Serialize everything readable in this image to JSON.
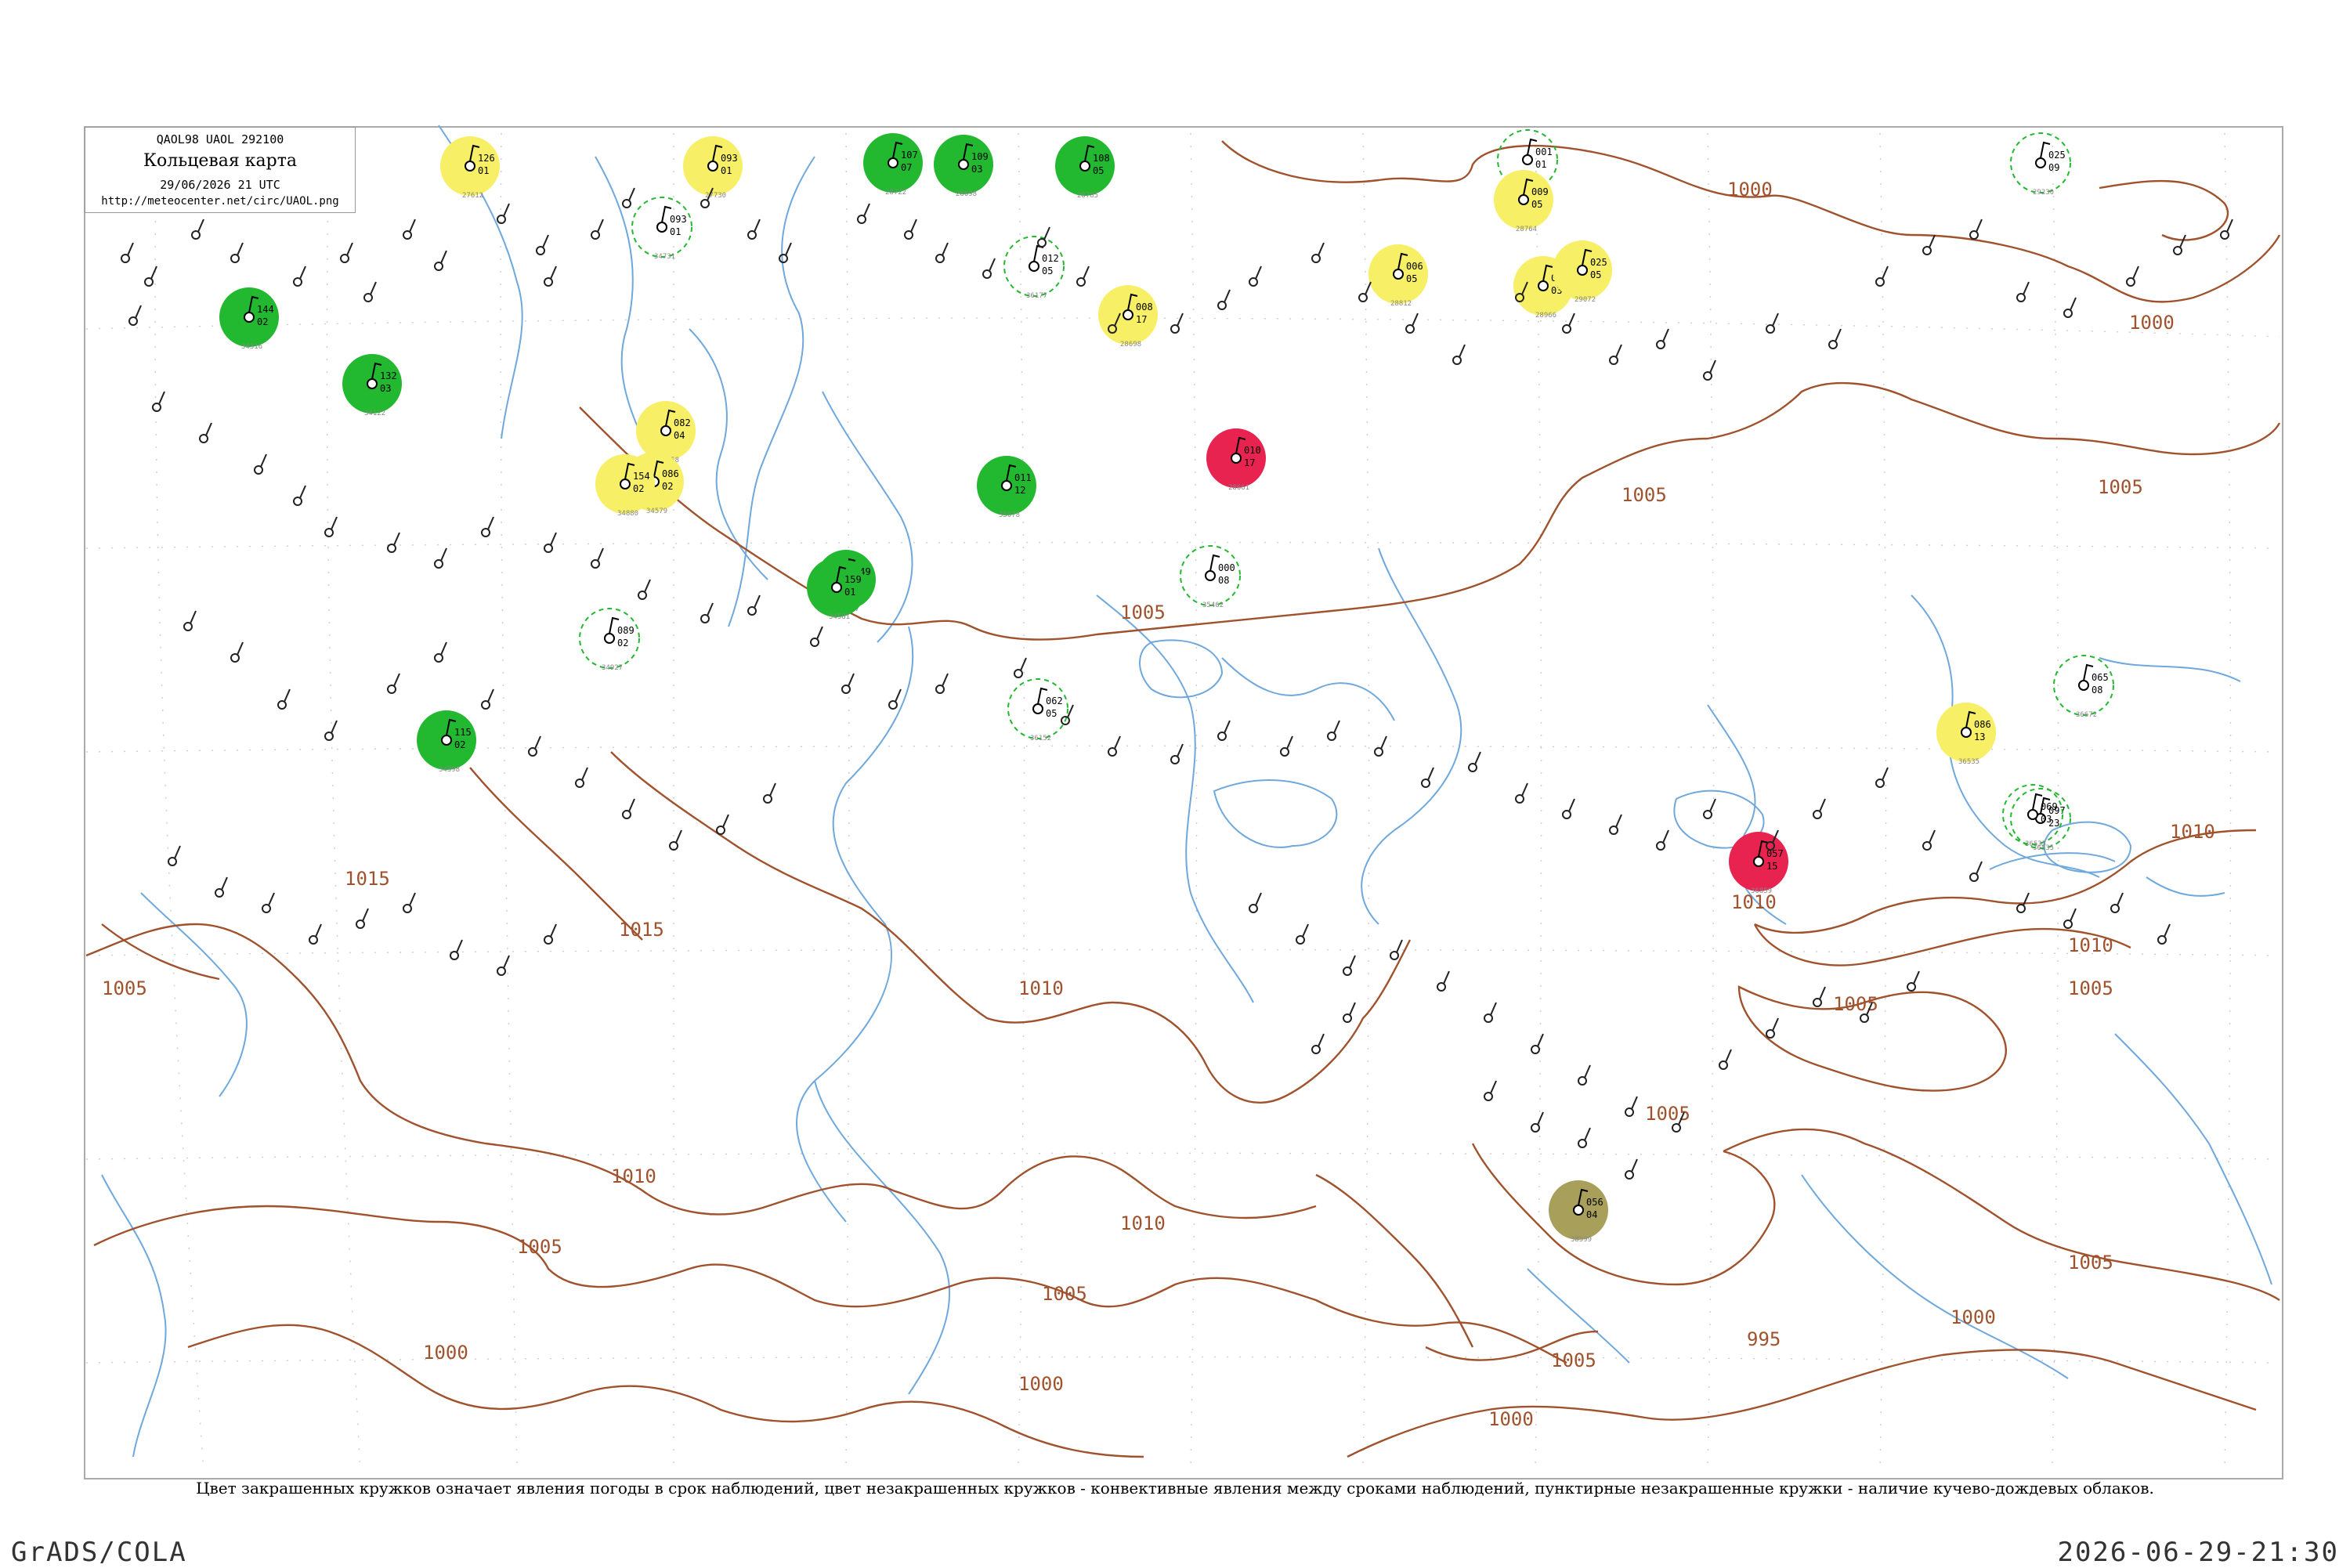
{
  "legend": {
    "header": "QAOL98  UAOL  292100",
    "title": "Кольцевая карта",
    "datetime": "29/06/2026 21 UTC",
    "url": "http://meteocenter.net/circ/UAOL.png"
  },
  "footnote": "Цвет закрашенных кружков означает явления погоды в срок наблюдений, цвет незакрашенных кружков - конвективные явления между сроками наблюдений, пунктирные незакрашенные кружки - наличие кучево-дождевых облаков.",
  "footer": {
    "software": "GrADS/COLA",
    "timestamp": "2026-06-29-21:30"
  },
  "colors": {
    "isobar": "#a0522d",
    "water": "#6fa8dc",
    "thunder": "#22b830",
    "shower": "#f7ef66",
    "fog": "#e8234f",
    "dust": "#a89f5a",
    "station": "#000000",
    "label": "#888888"
  },
  "isobar_labels": [
    "1000",
    "1005",
    "1010",
    "1015",
    "995"
  ],
  "stations": [
    {
      "p": "126",
      "t": "01",
      "id": "27612",
      "fill": "shower"
    },
    {
      "p": "093",
      "t": "01",
      "id": "27730",
      "fill": "shower"
    },
    {
      "p": "107",
      "t": "07",
      "id": "28722",
      "fill": "thunder"
    },
    {
      "p": "109",
      "t": "03",
      "id": "28698",
      "fill": "thunder"
    },
    {
      "p": "108",
      "t": "05",
      "id": "28785",
      "fill": "thunder"
    },
    {
      "p": "008",
      "t": "17",
      "id": "28698",
      "fill": "shower"
    },
    {
      "p": "001",
      "t": "01",
      "id": "28573",
      "fill": "none"
    },
    {
      "p": "009",
      "t": "05",
      "id": "28764",
      "fill": "shower"
    },
    {
      "p": "025",
      "t": "09",
      "id": "29230",
      "fill": "none"
    },
    {
      "p": "006",
      "t": "05",
      "id": "28812",
      "fill": "shower"
    },
    {
      "p": "020",
      "t": "03",
      "id": "28966",
      "fill": "shower"
    },
    {
      "p": "025",
      "t": "05",
      "id": "29072",
      "fill": "shower"
    },
    {
      "p": "144",
      "t": "02",
      "id": "34316",
      "fill": "thunder"
    },
    {
      "p": "132",
      "t": "03",
      "id": "34122",
      "fill": "thunder"
    },
    {
      "p": "082",
      "t": "04",
      "id": "34858",
      "fill": "shower"
    },
    {
      "p": "086",
      "t": "02",
      "id": "34579",
      "fill": "shower"
    },
    {
      "p": "154",
      "t": "02",
      "id": "34880",
      "fill": "shower"
    },
    {
      "p": "010",
      "t": "17",
      "id": "28661",
      "fill": "fog"
    },
    {
      "p": "011",
      "t": "12",
      "id": "35078",
      "fill": "thunder"
    },
    {
      "p": "012",
      "t": "05",
      "id": "36177",
      "fill": "none"
    },
    {
      "p": "093",
      "t": "01",
      "id": "34731",
      "fill": "none"
    },
    {
      "p": "149",
      "t": "01",
      "id": "34337",
      "fill": "thunder"
    },
    {
      "p": "115",
      "t": "02",
      "id": "34398",
      "fill": "thunder"
    },
    {
      "p": "159",
      "t": "01",
      "id": "34581",
      "fill": "thunder"
    },
    {
      "p": "086",
      "t": "13",
      "id": "36535",
      "fill": "shower"
    },
    {
      "p": "065",
      "t": "08",
      "id": "36672",
      "fill": "none"
    },
    {
      "p": "097",
      "t": "23",
      "id": "36535",
      "fill": "none"
    },
    {
      "p": "069",
      "t": "03",
      "id": "36535",
      "fill": "none"
    },
    {
      "p": "057",
      "t": "15",
      "id": "36859",
      "fill": "fog"
    },
    {
      "p": "056",
      "t": "04",
      "id": "38599",
      "fill": "dust"
    },
    {
      "p": "000",
      "t": "08",
      "id": "35462",
      "fill": "none"
    },
    {
      "p": "062",
      "t": "05",
      "id": "36152",
      "fill": "none"
    },
    {
      "p": "089",
      "t": "02",
      "id": "34927",
      "fill": "none"
    }
  ]
}
